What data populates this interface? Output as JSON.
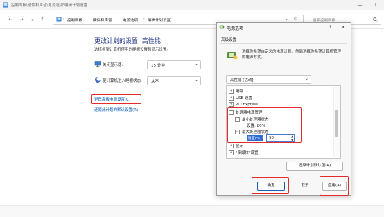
{
  "window": {
    "title": "控制面板\\硬件和声音\\电源选项\\编辑计划设置",
    "minimize_glyph": "—",
    "maximize_glyph": "☐"
  },
  "nav": {
    "back": "←",
    "forward": "→",
    "up": "↑",
    "refresh": "C"
  },
  "breadcrumb": [
    "控制面板",
    "硬件和声音",
    "电源选项",
    "编辑计划设置"
  ],
  "breadcrumb_sep": "›",
  "search": {
    "placeholder": "搜索控制面板"
  },
  "main": {
    "heading": "更改计划的设置: 高性能",
    "subtext": "选择希望计算机使用的睡眠设置和显示设置。",
    "rows": [
      {
        "label": "关闭显示器:",
        "value": "15 分钟"
      },
      {
        "label": "使计算机进入睡眠状态:",
        "value": "从不"
      }
    ],
    "link_advanced": "更改高级电源设置(C)",
    "link_restore": "还原此计划的默认设置(R)"
  },
  "dialog": {
    "title": "电源选项",
    "help_glyph": "?",
    "close_glyph": "✕",
    "tab": "高级设置",
    "description": "选择你希望自定义的电源计划，然后选择你希望计算机管理的电源方式。",
    "plan_select": "高性能 [活动]",
    "tree": {
      "sleep": "睡眠",
      "usb": "USB 设置",
      "pci": "PCI Express",
      "processor": "处理器电源管理",
      "min_state": "最小处理器状态",
      "min_setting": "设置: 80%",
      "max_state": "最大处理器状态",
      "max_setting_label": "设置(%):",
      "max_setting_value": "90",
      "display": "显示",
      "multimedia": "\"多媒体\"设置"
    },
    "restore_button": "还原计划默认值(R)",
    "ok": "确定",
    "cancel": "取消",
    "apply": "应用(A)"
  },
  "colors": {
    "accent": "#1e3287",
    "link": "#0057b8",
    "highlight": "#e32b2b"
  }
}
